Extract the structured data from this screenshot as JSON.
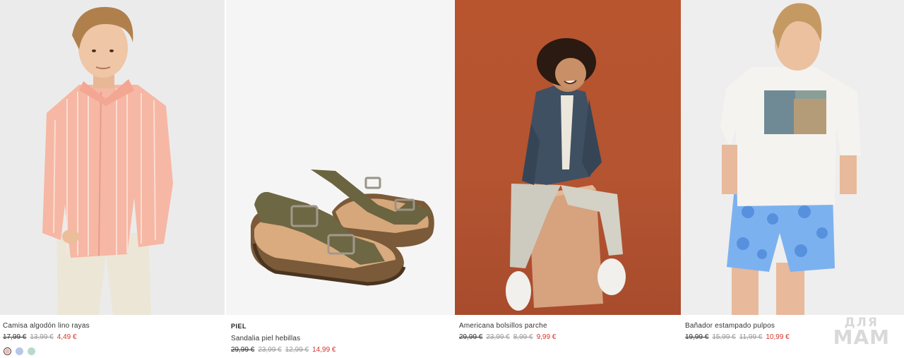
{
  "products": [
    {
      "name": "Camisa algodón lino rayas",
      "prices": [
        "17,99 €",
        "13,99 €"
      ],
      "sale": "4,49 €",
      "swatches": [
        "#f4b8aa",
        "#b8c7e8",
        "#b6dcc9"
      ]
    },
    {
      "tag": "PIEL",
      "name": "Sandalia piel hebillas",
      "prices": [
        "29,99 €",
        "23,99 €",
        "12,99 €"
      ],
      "sale": "14,99 €"
    },
    {
      "name": "Americana bolsillos parche",
      "prices": [
        "29,99 €",
        "23,99 €",
        "8,99 €"
      ],
      "sale": "9,99 €"
    },
    {
      "name": "Bañador estampado pulpos",
      "prices": [
        "19,99 €",
        "15,99 €",
        "11,99 €"
      ],
      "sale": "10,99 €"
    }
  ],
  "watermark": {
    "line1": "ДЛЯ",
    "line2": "МАМ"
  },
  "colors": {
    "sale": "#d4352d"
  }
}
